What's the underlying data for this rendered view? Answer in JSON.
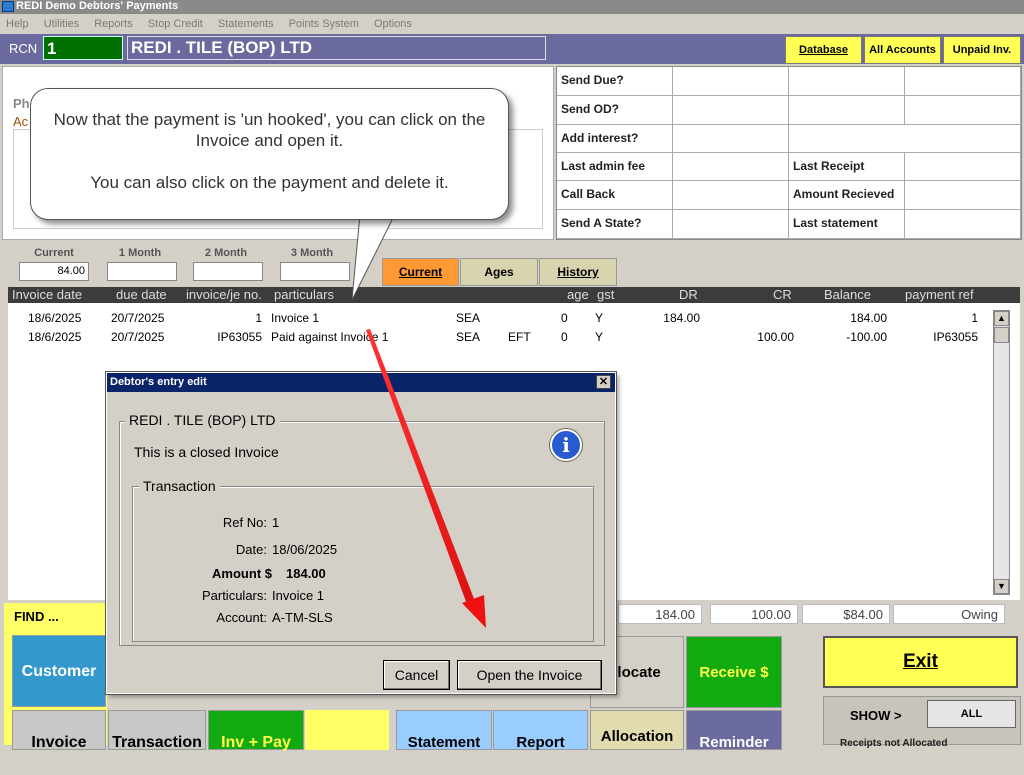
{
  "window": {
    "title": "REDI Demo Debtors' Payments"
  },
  "menu": [
    "Help",
    "Utilities",
    "Reports",
    "Stop Credit",
    "Statements",
    "Points System",
    "Options"
  ],
  "header": {
    "rcn_label": "RCN",
    "rcn_value": "1",
    "company_name": "REDI . TILE (BOP) LTD",
    "buttons": {
      "database": "Database",
      "all_accounts": "All Accounts",
      "unpaid_inv": "Unpaid Inv."
    }
  },
  "left_panel": {
    "ph_label": "Ph",
    "ac_label": "Ac"
  },
  "info_grid": {
    "send_due": "Send Due?",
    "send_od": "Send OD?",
    "add_interest": "Add interest?",
    "last_admin_fee": "Last admin fee",
    "call_back": "Call Back",
    "send_a_state": "Send A State?",
    "last_receipt": "Last Receipt",
    "amount_received": "Amount Recieved",
    "last_statement": "Last statement"
  },
  "ages": {
    "current_label": "Current",
    "current_value": "84.00",
    "m1_label": "1 Month",
    "m1_value": "",
    "m2_label": "2 Month",
    "m2_value": "",
    "m3_label": "3 Month",
    "m3_value": ""
  },
  "tabs": {
    "current": "Current",
    "ages": "Ages",
    "history": "History"
  },
  "table": {
    "headers": {
      "date": "Invoice date",
      "due": "due date",
      "invno": "invoice/je no.",
      "particulars": "particulars",
      "age": "age",
      "gst": "gst",
      "dr": "DR",
      "cr": "CR",
      "balance": "Balance",
      "payref": "payment ref"
    },
    "rows": [
      {
        "date": "18/6/2025",
        "due": "20/7/2025",
        "invno": "1",
        "particulars": "Invoice 1",
        "code": "SEA",
        "type": "",
        "age": "0",
        "gst": "Y",
        "dr": "184.00",
        "cr": "",
        "balance": "184.00",
        "payref": "1"
      },
      {
        "date": "18/6/2025",
        "due": "20/7/2025",
        "invno": "IP63055",
        "particulars": "Paid against Invoice 1",
        "code": "SEA",
        "type": "EFT",
        "age": "0",
        "gst": "Y",
        "dr": "",
        "cr": "100.00",
        "balance": "-100.00",
        "payref": "IP63055"
      }
    ]
  },
  "totals": {
    "dr": "184.00",
    "cr": "100.00",
    "balance": "$84.00",
    "status": "Owing"
  },
  "find": {
    "label": "FIND ...",
    "customer": "Customer",
    "invoice": "Invoice",
    "transaction": "Transaction",
    "inv_pay": "Inv + Pay"
  },
  "bottom_buttons": {
    "allocate": "llocate",
    "receive": "Receive $",
    "statement": "Statement",
    "report": "Report",
    "allocation": "Allocation",
    "reminder": "Reminder"
  },
  "exit": {
    "label": "Exit"
  },
  "show": {
    "label": "SHOW >",
    "all": "ALL",
    "not_allocated": "Receipts not Allocated"
  },
  "callout": {
    "line1": "Now that the payment is 'un hooked', you can click on the Invoice and open it.",
    "line2": "You can also click on the payment and delete it."
  },
  "dialog": {
    "title": "Debtor's entry edit",
    "close": "✕",
    "group_title": "REDI . TILE (BOP) LTD",
    "message": "This is a closed Invoice",
    "info_icon": "i",
    "transaction_title": "Transaction",
    "fields": {
      "ref_no_label": "Ref No:",
      "ref_no": "1",
      "date_label": "Date:",
      "date": "18/06/2025",
      "amount_label": "Amount $",
      "amount": "184.00",
      "particulars_label": "Particulars:",
      "particulars": "Invoice 1",
      "account_label": "Account:",
      "account": "A-TM-SLS"
    },
    "cancel": "Cancel",
    "open_invoice": "Open the Invoice"
  },
  "colors": {
    "accent_header": "#6a6a9e",
    "arrow": "#ee1111",
    "yellow": "#ffff55",
    "orange_tab": "#ff9933"
  }
}
